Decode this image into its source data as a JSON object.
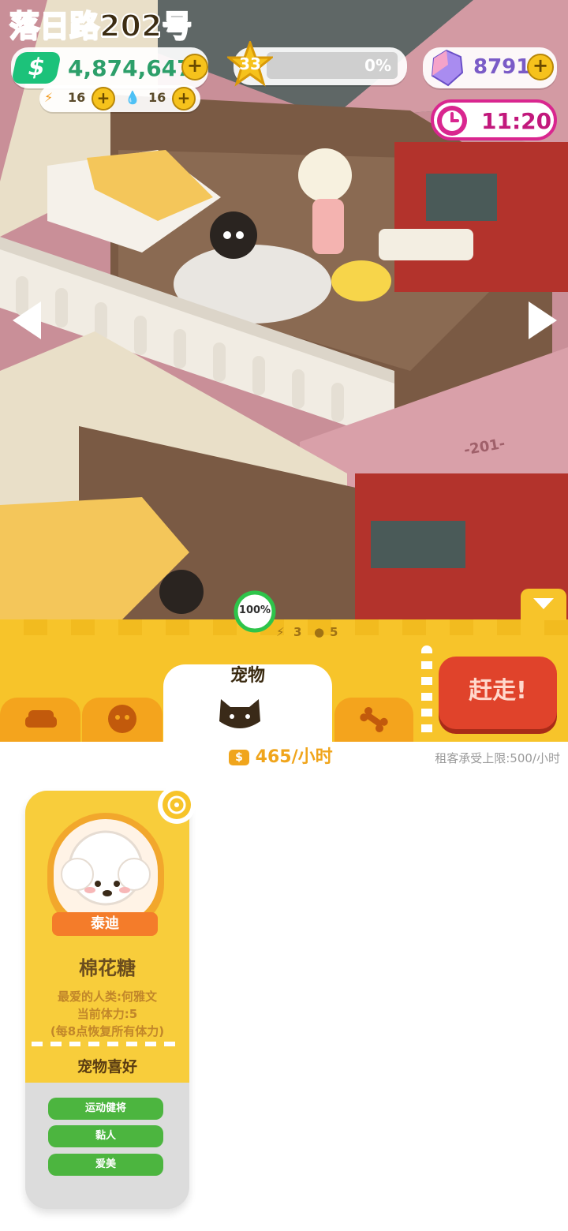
{
  "hud": {
    "money": "4,874,647",
    "energy": "16",
    "water": "16",
    "level": "33",
    "xp_percent": "0%",
    "xp_progress": 0.0,
    "gems": "8791",
    "timer": "11:20"
  },
  "building": {
    "address": "落日路202号",
    "completion": "100%",
    "energy_count": "3",
    "food_count": "5",
    "room_sign": "-201-"
  },
  "tabs": [
    {
      "id": "furniture",
      "icon": "sofa-icon",
      "active": false
    },
    {
      "id": "tenant",
      "icon": "face-icon",
      "active": false
    },
    {
      "id": "pet",
      "label": "宠物",
      "icon": "cat-icon",
      "active": true
    },
    {
      "id": "bone",
      "icon": "bone-icon",
      "active": false
    }
  ],
  "evict_button": "赶走!",
  "income": {
    "value": "465/小时",
    "limit": "租客承受上限:500/小时"
  },
  "pet_card": {
    "breed": "泰迪",
    "name": "棉花糖",
    "favorite_human": "最爱的人类:何雅文",
    "stamina": "当前体力:5",
    "recovery": "(每8点恢复所有体力)",
    "preferences_title": "宠物喜好",
    "preferences": [
      "运动健将",
      "黏人",
      "爱美"
    ]
  },
  "colors": {
    "accent_yellow": "#f7c42a",
    "evict_red": "#e0432b",
    "money_green": "#1cc27a",
    "pref_green": "#4cb53f",
    "timer_magenta": "#d9268f"
  }
}
